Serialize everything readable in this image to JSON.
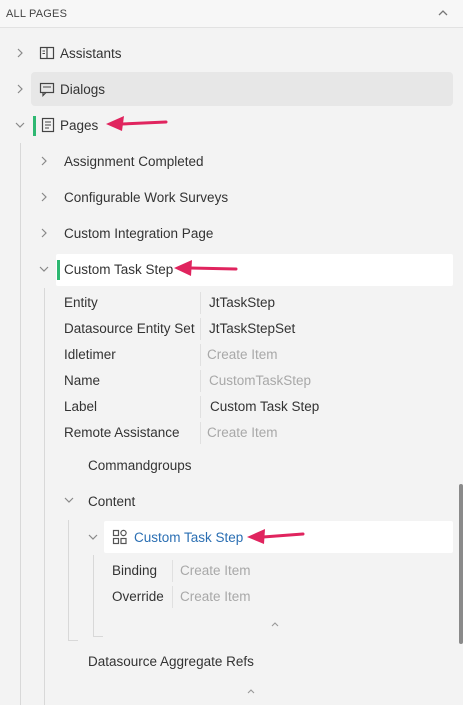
{
  "panel": {
    "title": "ALL PAGES",
    "collapse_icon": "chevron-up-icon"
  },
  "tree": {
    "assistants": {
      "label": "Assistants",
      "icon": "book-icon"
    },
    "dialogs": {
      "label": "Dialogs",
      "icon": "chat-icon"
    },
    "pages": {
      "label": "Pages",
      "icon": "document-icon"
    },
    "page_items": [
      {
        "label": "Assignment Completed"
      },
      {
        "label": "Configurable Work Surveys"
      },
      {
        "label": "Custom Integration Page"
      },
      {
        "label": "Custom Task Step"
      }
    ],
    "properties": [
      {
        "name": "Entity",
        "value": "JtTaskStep",
        "placeholder": false
      },
      {
        "name": "Datasource Entity Set",
        "value": "JtTaskStepSet",
        "placeholder": false
      },
      {
        "name": "Idletimer",
        "value": "Create Item",
        "placeholder": true
      },
      {
        "name": "Name",
        "value": "CustomTaskStep",
        "placeholder": true
      },
      {
        "name": "Label",
        "value": "Custom Task Step",
        "placeholder": false
      },
      {
        "name": "Remote Assistance",
        "value": "Create Item",
        "placeholder": true
      }
    ],
    "commandgroups": {
      "label": "Commandgroups"
    },
    "content": {
      "label": "Content"
    },
    "content_child": {
      "label": "Custom Task Step",
      "icon": "layout-icon",
      "properties": [
        {
          "name": "Binding",
          "value": "Create Item",
          "placeholder": true
        },
        {
          "name": "Override",
          "value": "Create Item",
          "placeholder": true
        }
      ]
    },
    "datasource_aggregate_refs": {
      "label": "Datasource Aggregate Refs"
    }
  },
  "colors": {
    "accent_green": "#2eb872",
    "link_blue": "#2b6fb3",
    "arrow_pink": "#e0245e",
    "placeholder_gray": "#a8a8a8"
  }
}
